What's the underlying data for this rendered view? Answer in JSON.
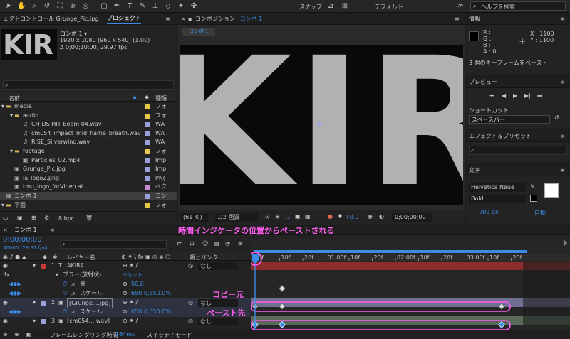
{
  "toolbar": {
    "snap_label": "スナップ",
    "workspace": "デフォルト",
    "help_placeholder": "ヘルプを検索"
  },
  "project_panel": {
    "tab_effects": "ェクトコントロール Grunge_Pic.jpg",
    "tab_project": "プロジェクト",
    "thumb_text": "KIR",
    "comp_name": "コンポ 1 ▾",
    "comp_size": "1920 x 1080 (960 x 540) (1.00)",
    "comp_duration": "Δ 0;00;10;00, 29.97 fps",
    "search_icon": "search-icon",
    "col_name": "名前",
    "col_type": "種類",
    "items": [
      {
        "name": "media",
        "type": "フォ",
        "indent": 0,
        "kind": "folder",
        "color": "#e6c84a"
      },
      {
        "name": "audio",
        "type": "フォ",
        "indent": 1,
        "kind": "folder",
        "color": "#e6c84a"
      },
      {
        "name": "CH-DS HIT Boom 04.wav",
        "type": "WA",
        "indent": 2,
        "kind": "audio",
        "color": "#9aa0d8"
      },
      {
        "name": "cm054_impact_mid_flame_breath.wav",
        "type": "WA",
        "indent": 2,
        "kind": "audio",
        "color": "#9aa0d8"
      },
      {
        "name": "RISE_Silverwind.wav",
        "type": "WA",
        "indent": 2,
        "kind": "audio",
        "color": "#9aa0d8"
      },
      {
        "name": "footage",
        "type": "フォ",
        "indent": 1,
        "kind": "folder",
        "color": "#e6c84a"
      },
      {
        "name": "Particles_02.mp4",
        "type": "Imp",
        "indent": 2,
        "kind": "video",
        "color": "#9aa0d8"
      },
      {
        "name": "Grunge_Pic.jpg",
        "type": "Imp",
        "indent": 1,
        "kind": "image",
        "color": "#9aa0d8"
      },
      {
        "name": "la_logo2.png",
        "type": "PN(",
        "indent": 1,
        "kind": "image",
        "color": "#9aa0d8"
      },
      {
        "name": "tmu_logo_forVideo.ai",
        "type": "ベク",
        "indent": 1,
        "kind": "vector",
        "color": "#c88ad0"
      },
      {
        "name": "コンポ 1",
        "type": "コン",
        "indent": 0,
        "kind": "comp",
        "color": "#9aa0d8"
      },
      {
        "name": "平面",
        "type": "フォ",
        "indent": 0,
        "kind": "folder",
        "color": "#e6c84a"
      }
    ],
    "bpc": "8 bpc"
  },
  "comp_panel": {
    "tab_title": "コンポジション",
    "tab_comp": "コンポ 1",
    "comp_tab": "コンポ 1",
    "preview_text": "KIR",
    "zoom": "(61 %)",
    "quality": "1/2 画質",
    "exposure": "+0.0",
    "timecode": "0;00;00;00"
  },
  "info_panel": {
    "title": "情報",
    "r": "R :",
    "g": "G :",
    "b": "B :",
    "a": "A : 0",
    "x": "X : 1100",
    "y": "Y : 1100",
    "status": "3 個のキーフレームをペースト"
  },
  "preview_panel": {
    "title": "プレビュー",
    "shortcut_label": "ショートカット",
    "shortcut_value": "スペースバー"
  },
  "effects_panel": {
    "title": "エフェクト＆プリセット"
  },
  "char_panel": {
    "title": "文字",
    "font": "Helvetica Neue",
    "style": "Bold",
    "size": "200 px",
    "auto": "自動"
  },
  "timeline": {
    "tab": "コンポ 1",
    "timecode": "0;00;00;00",
    "frames": "00000 (29.97 fps)",
    "annotation_top": "時間インジケータの位置からペーストされる",
    "col_layer": "レイヤー名",
    "col_parent": "親とリンク",
    "ruler": [
      "0f",
      "10f",
      "20f",
      "01:00f",
      "10f",
      "20f",
      "02:00f",
      "10f",
      "20f",
      "03:00f",
      "10f",
      "20f"
    ],
    "layers": [
      {
        "num": "1",
        "name": "AKIRA",
        "parent": "なし",
        "kind": "layer",
        "color": "#c23a3a"
      },
      {
        "name": "ブラー(放射状)",
        "value": "リセット",
        "kind": "effect"
      },
      {
        "name": "量",
        "value": "50.0",
        "kind": "prop"
      },
      {
        "name": "スケール",
        "value": "650.0,650.0%",
        "kind": "prop"
      },
      {
        "num": "2",
        "name": "[Grunge....jpg]",
        "parent": "なし",
        "kind": "layer",
        "color": "#9aa0d8"
      },
      {
        "name": "スケール",
        "value": "650.0,650.0%",
        "kind": "prop"
      },
      {
        "num": "3",
        "name": "[cm054....wav]",
        "parent": "なし",
        "kind": "layer",
        "color": "#9aa0d8"
      }
    ],
    "label_copy": "コピー元",
    "label_paste": "ペースト先",
    "footer_render": "フレームレンダリング時間",
    "footer_ms": "164ms",
    "footer_switch": "スイッチ / モード"
  }
}
